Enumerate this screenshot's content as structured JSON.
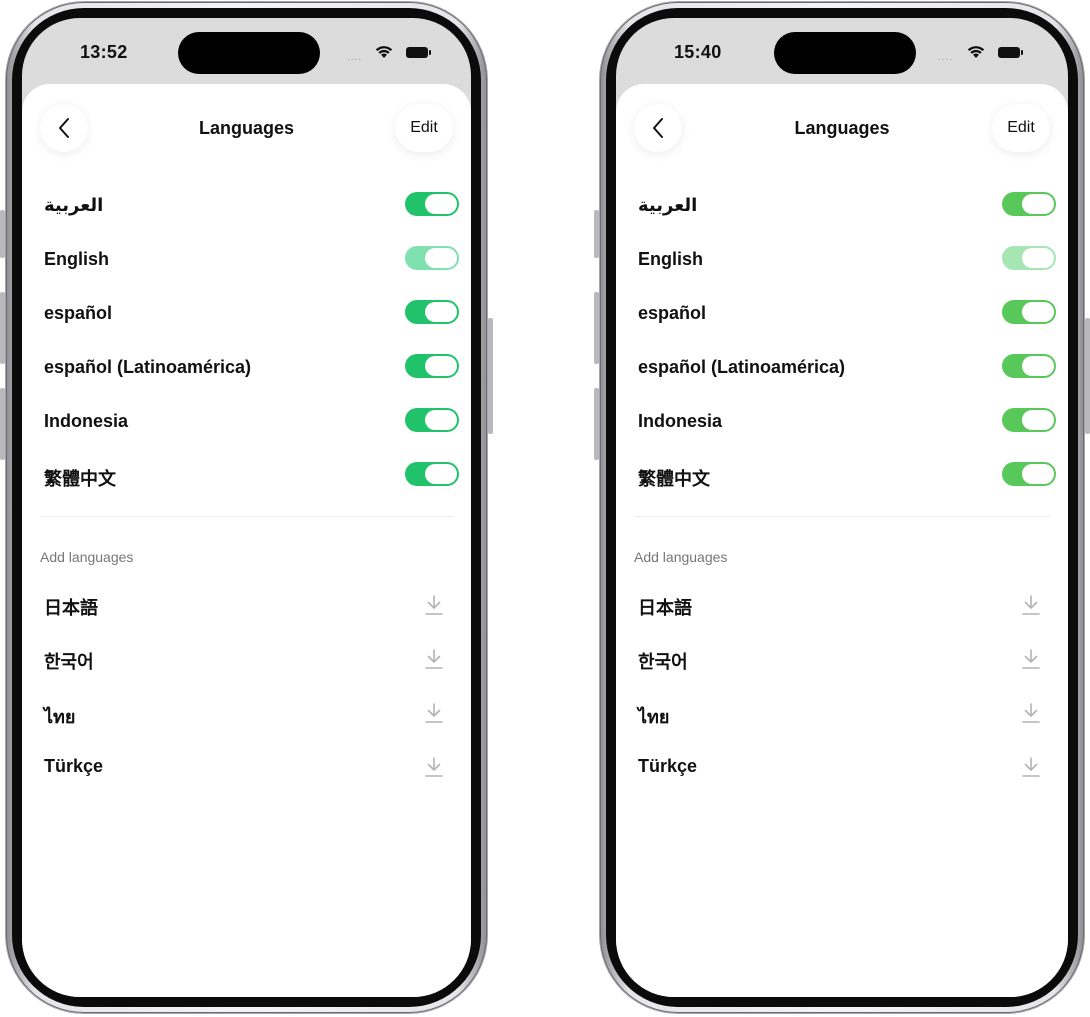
{
  "screens": [
    {
      "status": {
        "time": "13:52",
        "signal": "....",
        "wifi_icon": "wifi-icon",
        "battery_icon": "battery-icon"
      },
      "header": {
        "title": "Languages",
        "edit_label": "Edit",
        "back_icon": "chevron-left-icon"
      },
      "enabled_languages": [
        {
          "label": "العربية",
          "enabled": true,
          "dimmed": false
        },
        {
          "label": "English",
          "enabled": true,
          "dimmed": true
        },
        {
          "label": "español",
          "enabled": true,
          "dimmed": false
        },
        {
          "label": "español (Latinoamérica)",
          "enabled": true,
          "dimmed": false
        },
        {
          "label": "Indonesia",
          "enabled": true,
          "dimmed": false
        },
        {
          "label": "繁體中文",
          "enabled": true,
          "dimmed": false
        }
      ],
      "add_section": {
        "title": "Add languages",
        "items": [
          {
            "label": "日本語",
            "icon": "download-icon"
          },
          {
            "label": "한국어",
            "icon": "download-icon"
          },
          {
            "label": "ไทย",
            "icon": "download-icon"
          },
          {
            "label": "Türkçe",
            "icon": "download-icon"
          }
        ]
      },
      "colors": {
        "toggle_on": "#21c36a",
        "toggle_dim": "#7fe0b0"
      }
    },
    {
      "status": {
        "time": "15:40",
        "signal": "....",
        "wifi_icon": "wifi-icon",
        "battery_icon": "battery-icon"
      },
      "header": {
        "title": "Languages",
        "edit_label": "Edit",
        "back_icon": "chevron-left-icon"
      },
      "enabled_languages": [
        {
          "label": "العربية",
          "enabled": true,
          "dimmed": false
        },
        {
          "label": "English",
          "enabled": true,
          "dimmed": true
        },
        {
          "label": "español",
          "enabled": true,
          "dimmed": false
        },
        {
          "label": "español (Latinoamérica)",
          "enabled": true,
          "dimmed": false
        },
        {
          "label": "Indonesia",
          "enabled": true,
          "dimmed": false
        },
        {
          "label": "繁體中文",
          "enabled": true,
          "dimmed": false
        }
      ],
      "add_section": {
        "title": "Add languages",
        "items": [
          {
            "label": "日本語",
            "icon": "download-icon"
          },
          {
            "label": "한국어",
            "icon": "download-icon"
          },
          {
            "label": "ไทย",
            "icon": "download-icon"
          },
          {
            "label": "Türkçe",
            "icon": "download-icon"
          }
        ]
      },
      "colors": {
        "toggle_on": "#59c85a",
        "toggle_dim": "#a6e6b3"
      }
    }
  ]
}
